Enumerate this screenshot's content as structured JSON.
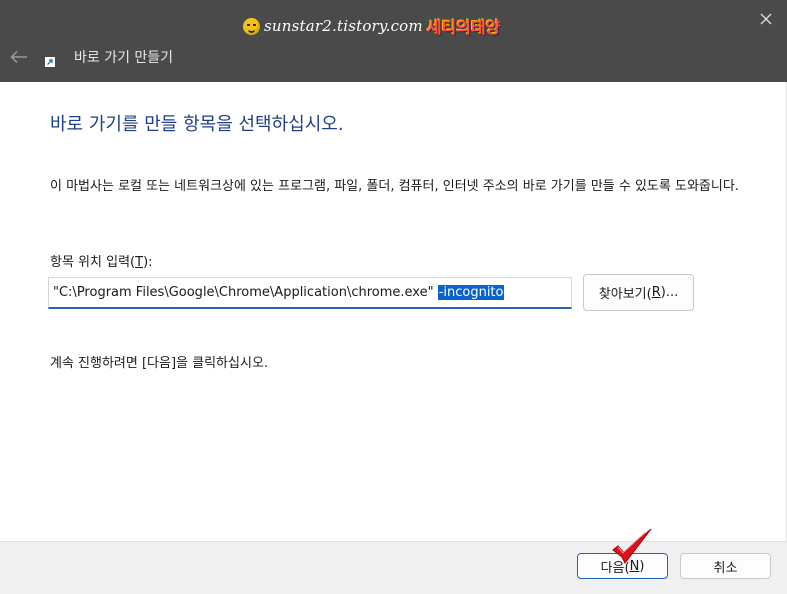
{
  "watermark": {
    "url": "sunstar2.tistory.com",
    "brand": "세티의태양",
    "face_icon": "smiley-face-icon"
  },
  "titlebar": {
    "title": "바로 가기 만들기",
    "back_icon": "arrow-left-icon",
    "close_icon": "close-icon",
    "shortcut_icon": "shortcut-arrow-icon"
  },
  "content": {
    "heading": "바로 가기를 만들 항목을 선택하십시오.",
    "description": "이 마법사는 로컬 또는 네트워크상에 있는 프로그램, 파일, 폴더, 컴퓨터, 인터넷 주소의 바로 가기를 만들 수 있도록 도와줍니다.",
    "field_label_prefix": "항목 위치 입력(",
    "field_label_key": "T",
    "field_label_suffix": "):",
    "location_value_plain": "\"C:\\Program Files\\Google\\Chrome\\Application\\chrome.exe\" ",
    "location_value_selected": "-incognito",
    "browse_prefix": "찾아보기(",
    "browse_key": "R",
    "browse_suffix": ")...",
    "continue_text": "계속 진행하려면 [다음]을 클릭하십시오."
  },
  "footer": {
    "next_prefix": "다음(",
    "next_key": "N",
    "next_suffix": ")",
    "cancel_label": "취소"
  },
  "colors": {
    "titlebar": "#4a4a4a",
    "heading": "#1f3f8a",
    "selection": "#0a64d0",
    "accent_border": "#2a66b8",
    "checkmark": "#e0101a"
  }
}
